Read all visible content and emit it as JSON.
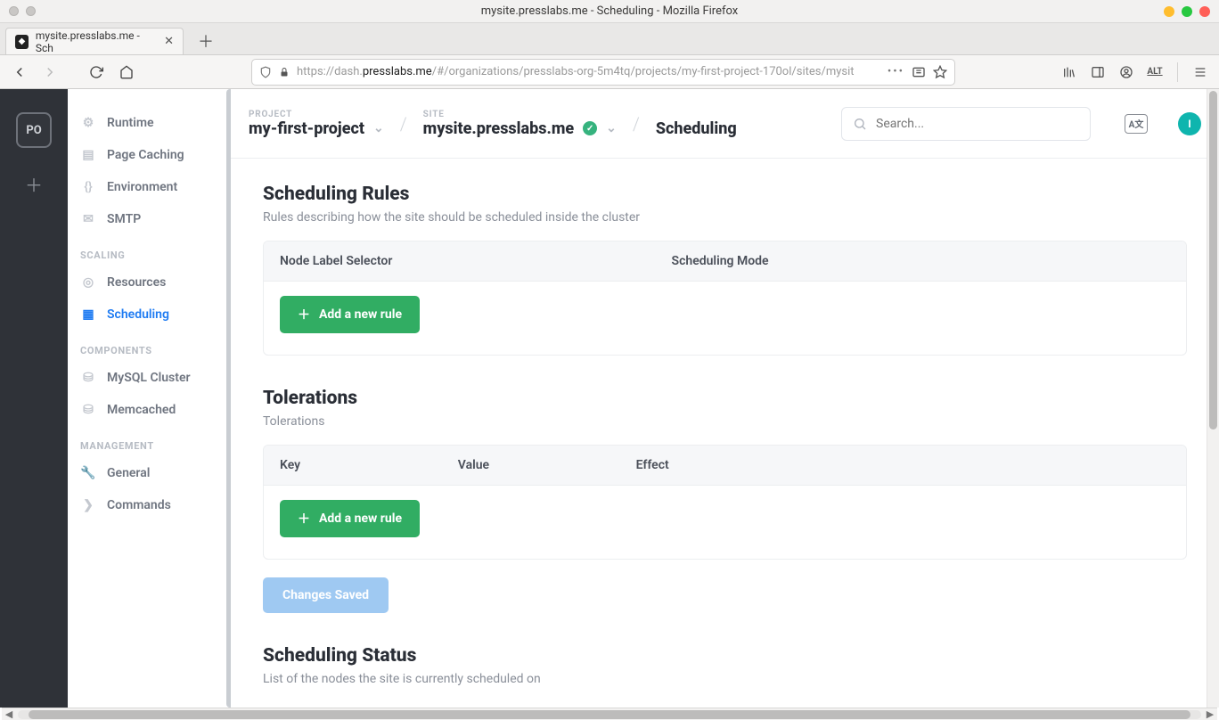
{
  "window": {
    "title": "mysite.presslabs.me - Scheduling - Mozilla Firefox"
  },
  "tab": {
    "title": "mysite.presslabs.me - Sch"
  },
  "url": {
    "shield": "⬚",
    "lock": "🔒",
    "proto": "https://dash.",
    "host": "presslabs.me",
    "path": "/#/organizations/presslabs-org-5m4tq/projects/my-first-project-170ol/sites/mysit"
  },
  "leftrail": {
    "org_initials": "PO"
  },
  "sidebar": {
    "items": [
      {
        "label": "Runtime"
      },
      {
        "label": "Page Caching"
      },
      {
        "label": "Environment"
      },
      {
        "label": "SMTP"
      }
    ],
    "group_scaling": "SCALING",
    "scaling": [
      {
        "label": "Resources"
      },
      {
        "label": "Scheduling"
      }
    ],
    "group_components": "COMPONENTS",
    "components": [
      {
        "label": "MySQL Cluster"
      },
      {
        "label": "Memcached"
      }
    ],
    "group_management": "MANAGEMENT",
    "management": [
      {
        "label": "General"
      },
      {
        "label": "Commands"
      }
    ]
  },
  "breadcrumb": {
    "project_label": "PROJECT",
    "project_value": "my-first-project",
    "site_label": "SITE",
    "site_value": "mysite.presslabs.me",
    "page_value": "Scheduling"
  },
  "search": {
    "placeholder": "Search..."
  },
  "lang": "A文",
  "avatar": "I",
  "sections": {
    "rules": {
      "title": "Scheduling Rules",
      "subtitle": "Rules describing how the site should be scheduled inside the cluster",
      "columns": {
        "c1": "Node Label Selector",
        "c2": "Scheduling Mode"
      },
      "add_button": "Add a new rule"
    },
    "tolerations": {
      "title": "Tolerations",
      "subtitle": "Tolerations",
      "columns": {
        "c1": "Key",
        "c2": "Value",
        "c3": "Effect"
      },
      "add_button": "Add a new rule"
    },
    "saved_button": "Changes Saved",
    "status": {
      "title": "Scheduling Status",
      "subtitle": "List of the nodes the site is currently scheduled on"
    }
  }
}
